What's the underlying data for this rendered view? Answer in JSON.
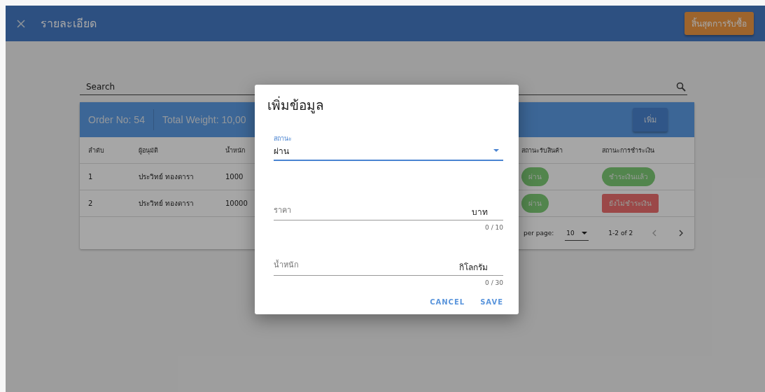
{
  "app_bar": {
    "title": "รายละเอียด",
    "action": "สิ้นสุดการรับซื้อ"
  },
  "search": {
    "placeholder": "Search"
  },
  "card": {
    "order": "Order No: 54",
    "total_weight": "Total Weight: 10,00",
    "add_button": "เพิ่ม"
  },
  "table": {
    "columns": [
      "ลำดับ",
      "ผู้อนุมัติ",
      "น้ำหนัก",
      "",
      "สถานะรับสินค้า",
      "สถานะการชำระเงิน"
    ],
    "rows": [
      {
        "index": "1",
        "approver": "ประวิทย์ ทองดารา",
        "weight": "1000",
        "receive_status": {
          "text": "ผ่าน",
          "kind": "pass"
        },
        "payment_status": {
          "text": "ชำระเงินแล้ว",
          "kind": "paid"
        }
      },
      {
        "index": "2",
        "approver": "ประวิทย์ ทองดารา",
        "weight": "10000",
        "receive_status": {
          "text": "ผ่าน",
          "kind": "pass"
        },
        "payment_status": {
          "text": "ยังไม่ชำระเงิน",
          "kind": "unpaid"
        }
      }
    ]
  },
  "pagination": {
    "rows_per_page_label": "per page:",
    "rows_per_page": "10",
    "range": "1-2 of 2",
    "prev_disabled": true,
    "next_disabled": false
  },
  "dialog": {
    "title": "เพิ่มข้อมูล",
    "fields": [
      {
        "kind": "select",
        "label": "สถานะ",
        "value": "ผ่าน",
        "focused": true
      },
      {
        "kind": "text",
        "placeholder": "ราคา",
        "suffix": "บาท",
        "counter": "0 / 10",
        "focused": false
      },
      {
        "kind": "text",
        "placeholder": "น้ำหนัก",
        "suffix": "กิโลกรัม",
        "counter": "0 / 30",
        "focused": false
      }
    ],
    "buttons": [
      "CANCEL",
      "SAVE"
    ]
  }
}
